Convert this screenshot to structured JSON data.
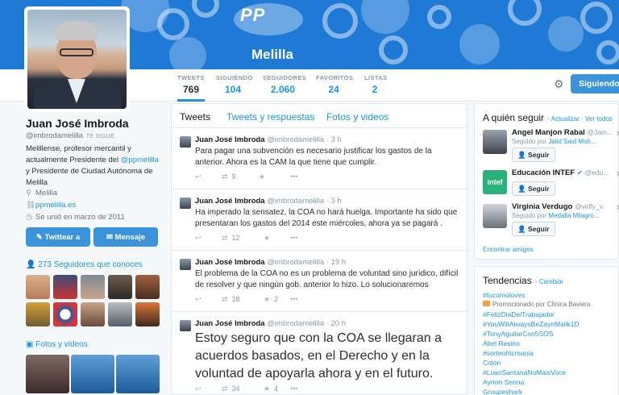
{
  "banner": {
    "logo_text": "PP",
    "region": "Melilla"
  },
  "nav": {
    "stats": [
      {
        "label": "TWEETS",
        "value": "769"
      },
      {
        "label": "SIGUIENDO",
        "value": "104"
      },
      {
        "label": "SEGUIDORES",
        "value": "2.060"
      },
      {
        "label": "FAVORITOS",
        "value": "24"
      },
      {
        "label": "LISTAS",
        "value": "2"
      }
    ],
    "following_label": "Siguiendo"
  },
  "profile": {
    "name": "Juan José Imbroda",
    "handle": "@imbrodamelilla",
    "follows_you": "TE SIGUE",
    "bio_pre": "Melillense, profesor mercantil y actualmente Presidente del ",
    "bio_link": "@ppmelilla",
    "bio_post": " y Presidente de Ciudad Autónoma de Melilla",
    "location": "Melilla",
    "website": "ppmelilla.es",
    "joined": "Se unió en marzo de 2011",
    "tweet_to": "Twittear a",
    "message": "Mensaje",
    "followers_you_know": "273 Seguidores que conoces",
    "photos_videos": "Fotos y videos"
  },
  "timeline": {
    "tabs": [
      "Tweets",
      "Tweets y respuestas",
      "Fotos y videos"
    ],
    "tweets": [
      {
        "name": "Juan José Imbroda",
        "handle": "@imbrodamelilla",
        "time": "3 h",
        "text": "Para pagar una subvención es necesario justificar los gastos de la anterior. Ahora es la CAM la que tiene que cumplir.",
        "retweets": "9",
        "favorites": ""
      },
      {
        "name": "Juan José Imbroda",
        "handle": "@imbrodamelilla",
        "time": "3 h",
        "text": "Ha imperado la sensatez, la COA no hará huelga. Importante ha sido que presentaran los gastos del 2014 este miércoles, ahora ya se pagará .",
        "retweets": "12",
        "favorites": ""
      },
      {
        "name": "Juan José Imbroda",
        "handle": "@imbrodamelilla",
        "time": "19 h",
        "text": "El problema de la COA no es un problema de voluntad sino jurídico, difícil de resolver y que ningún gob. anterior lo hizo. Lo solucionaremos",
        "retweets": "18",
        "favorites": "2"
      },
      {
        "name": "Juan José Imbroda",
        "handle": "@imbrodamelilla",
        "time": "20 h",
        "text": "Estoy seguro que con la COA se llegaran a acuerdos basados, en el Derecho y en la voluntad de apoyarla ahora y en el futuro.",
        "retweets": "34",
        "favorites": "4"
      }
    ]
  },
  "who_to_follow": {
    "title": "A quién seguir",
    "refresh": "Actualizar",
    "view_all": "Ver todos",
    "follow_label": "Seguir",
    "users": [
      {
        "name": "Angel Manjon Rabal",
        "handle": "@Jam...",
        "followed_by_pre": "Seguido por ",
        "followed_by": "Jalid Said Moh..."
      },
      {
        "name": "Educación INTEF",
        "handle": "@edu...",
        "followed_by_pre": "",
        "followed_by": ""
      },
      {
        "name": "Virginia Verdugo",
        "handle": "@virfly_v",
        "followed_by_pre": "Seguido por ",
        "followed_by": "Medalla Milagro..."
      }
    ],
    "find_friends": "Encontrar amigos"
  },
  "trends": {
    "title": "Tendencias",
    "change": "Cambiar",
    "items": [
      "#tucomoloves"
    ],
    "promoted": "Promocionado por Clínica Baviera",
    "items2": [
      "#FelizDiaDelTrabajador",
      "#YouWillAlwaysBeZaynMalik1D",
      "#TonyAguilarCon5SOS",
      "Abel Resino",
      "#sorteohtcmania",
      "Colon",
      "#LuanSantanaNoMaisVoce",
      "Ayrton Senna",
      "Groupeshark"
    ]
  },
  "colors": {
    "accent": "#1b95e0",
    "button": "#3b94d9",
    "banner": "#1f7ad6"
  }
}
